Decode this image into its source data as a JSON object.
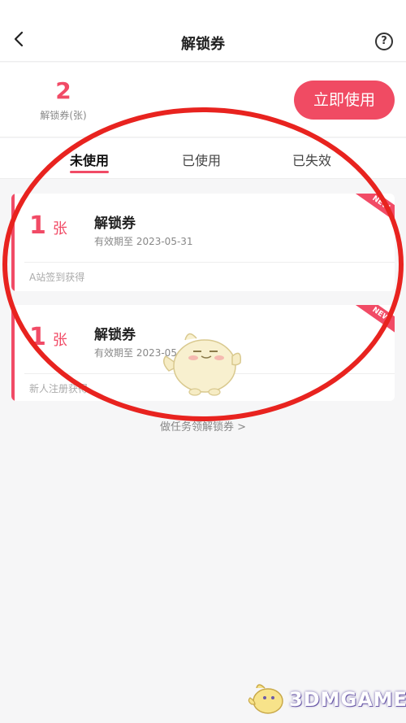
{
  "header": {
    "title": "解锁券",
    "back_icon": "back-arrow-icon",
    "help_icon": "question-mark-icon",
    "help_glyph": "?"
  },
  "summary": {
    "count": "2",
    "count_label": "解锁券(张)",
    "use_button": "立即使用"
  },
  "tabs": [
    {
      "label": "未使用",
      "active": true
    },
    {
      "label": "已使用",
      "active": false
    },
    {
      "label": "已失效",
      "active": false
    }
  ],
  "coupons": [
    {
      "quantity": "1",
      "unit": "张",
      "name": "解锁券",
      "expiry": "有效期至 2023-05-31",
      "source": "A站签到获得",
      "badge": "NEW"
    },
    {
      "quantity": "1",
      "unit": "张",
      "name": "解锁券",
      "expiry": "有效期至 2023-05-30",
      "source": "新人注册获得",
      "badge": "NEW"
    }
  ],
  "more_link": "做任务领解锁券 >",
  "watermark": "3DMGAME",
  "colors": {
    "accent": "#f14b66",
    "button": "#f04b63",
    "annotation_circle": "#e8231f",
    "background": "#f6f6f7"
  }
}
